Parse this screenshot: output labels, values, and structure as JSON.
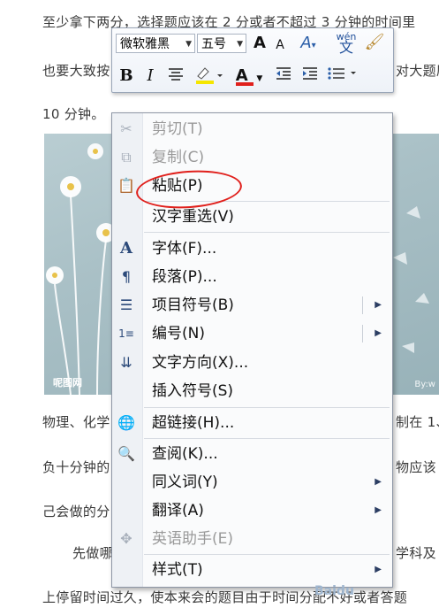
{
  "document": {
    "line1": "至少拿下两分，选择题应该在 2 分或者不超过 3 分钟的时间里",
    "line2a": "也要大致按",
    "line2b": "对大题原",
    "line3": "10 分钟。",
    "line4a": "物理、化学",
    "line4b": "制在 1、",
    "line5a": "负十分钟的",
    "line5b": "物应该",
    "line6a": "己会做的分",
    "line7a": "先做哪",
    "line7b": "学科及",
    "line8": "上停留时间过久，使本来会的题目由于时间分配不好或者答题",
    "image_watermark_left": "呢图网",
    "image_watermark_right": "By:w",
    "baidu_watermark": "Baidu"
  },
  "mini_toolbar": {
    "font_name": "微软雅黑",
    "font_size": "五号",
    "grow_font": "A",
    "shrink_font": "A",
    "bold": "B",
    "italic": "I",
    "font_color_label": "A",
    "highlight_color": "#f5e600",
    "font_color": "#e0201c"
  },
  "context_menu": {
    "items": [
      {
        "label": "剪切(T)",
        "icon": "scissors-icon",
        "disabled": true
      },
      {
        "label": "复制(C)",
        "icon": "copy-icon",
        "disabled": true
      },
      {
        "label": "粘贴(P)",
        "icon": "paste-icon",
        "disabled": false
      },
      {
        "label": "汉字重选(V)",
        "icon": "",
        "disabled": false
      },
      {
        "label": "字体(F)...",
        "icon": "font-icon",
        "disabled": false
      },
      {
        "label": "段落(P)...",
        "icon": "paragraph-icon",
        "disabled": false
      },
      {
        "label": "项目符号(B)",
        "icon": "bullets-icon",
        "disabled": false,
        "submenu": true
      },
      {
        "label": "编号(N)",
        "icon": "numbering-icon",
        "disabled": false,
        "submenu": true
      },
      {
        "label": "文字方向(X)...",
        "icon": "text-direction-icon",
        "disabled": false
      },
      {
        "label": "插入符号(S)",
        "icon": "",
        "disabled": false
      },
      {
        "label": "超链接(H)...",
        "icon": "hyperlink-icon",
        "disabled": false
      },
      {
        "label": "查阅(K)...",
        "icon": "research-icon",
        "disabled": false
      },
      {
        "label": "同义词(Y)",
        "icon": "",
        "disabled": false,
        "submenu": true
      },
      {
        "label": "翻译(A)",
        "icon": "",
        "disabled": false,
        "submenu": true
      },
      {
        "label": "英语助手(E)",
        "icon": "english-assistant-icon",
        "disabled": true
      },
      {
        "label": "样式(T)",
        "icon": "",
        "disabled": false,
        "submenu": true
      }
    ],
    "annotation_color": "#e0201c"
  }
}
